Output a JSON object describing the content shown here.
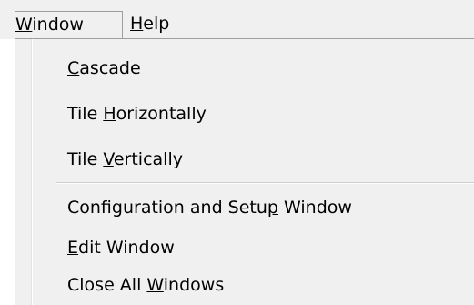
{
  "menubar": {
    "window": {
      "mnemonic": "W",
      "rest": "indow"
    },
    "help": {
      "mnemonic": "H",
      "rest": "elp"
    }
  },
  "menu": {
    "items": [
      {
        "before": "",
        "mnemonic": "C",
        "after": "ascade"
      },
      {
        "before": "Tile ",
        "mnemonic": "H",
        "after": "orizontally"
      },
      {
        "before": "Tile ",
        "mnemonic": "V",
        "after": "ertically"
      },
      {
        "before": "Configuration and Setu",
        "mnemonic": "p",
        "after": " Window"
      },
      {
        "before": "",
        "mnemonic": "E",
        "after": "dit Window"
      },
      {
        "before": "Close All ",
        "mnemonic": "W",
        "after": "indows"
      }
    ]
  }
}
